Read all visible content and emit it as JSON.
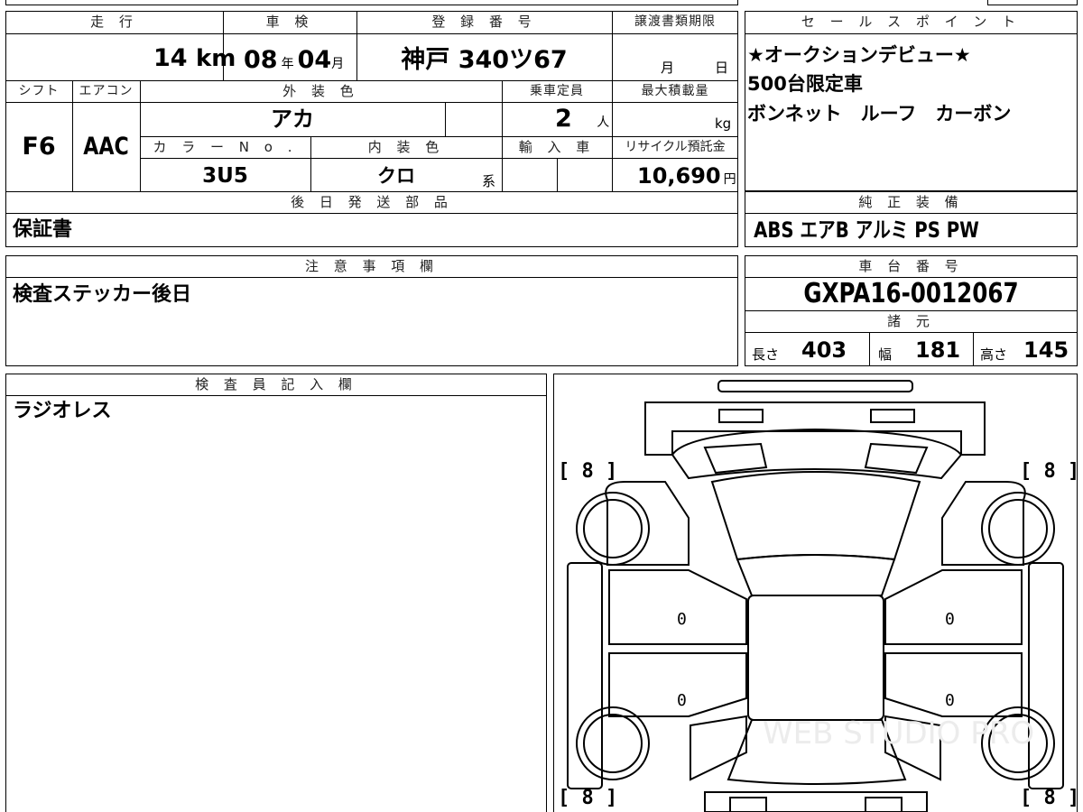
{
  "top_section": {
    "mileage": {
      "header": "走 行",
      "value": "14",
      "unit": "km"
    },
    "inspection": {
      "header": "車 検",
      "year": "08",
      "year_unit": "年",
      "month": "04",
      "month_unit": "月"
    },
    "registration": {
      "header": "登 録 番 号",
      "value": "神戸 340ツ67"
    },
    "transfer_deadline": {
      "header": "譲渡書類期限",
      "month_unit": "月",
      "day_unit": "日"
    },
    "shift": {
      "header": "シフト",
      "value": "F6"
    },
    "aircon": {
      "header": "エアコン",
      "value": "AAC"
    },
    "exterior_color": {
      "header": "外 装 色",
      "value": "アカ"
    },
    "capacity": {
      "header": "乗車定員",
      "value": "2",
      "unit": "人"
    },
    "max_load": {
      "header": "最大積載量",
      "unit": "kg"
    },
    "color_no": {
      "header": "カ ラ ー N o .",
      "value": "3U5"
    },
    "interior_color": {
      "header": "内 装 色",
      "value": "クロ",
      "unit": "系"
    },
    "import": {
      "header": "輸 入 車"
    },
    "recycle": {
      "header": "リサイクル預託金",
      "value": "10,690",
      "unit": "円"
    },
    "later_parts": {
      "header": "後 日 発 送 部 品",
      "value": "保証書"
    }
  },
  "sales_point": {
    "header": "セ ー ル ス ポ イ ン ト",
    "lines": [
      "★オークションデビュー★",
      "500台限定車",
      "ボンネット　ルーフ　カーボン"
    ]
  },
  "equipment": {
    "header": "純 正 装 備",
    "value": "ABS エアB アルミ PS PW"
  },
  "caution": {
    "header": "注 意 事 項 欄",
    "value": "検査ステッカー後日"
  },
  "chassis": {
    "header": "車 台 番 号",
    "value": "GXPA16-0012067"
  },
  "specs": {
    "header": "諸 元",
    "length_label": "長さ",
    "length": "403",
    "width_label": "幅",
    "width": "181",
    "height_label": "高さ",
    "height": "145"
  },
  "inspector": {
    "header": "検 査 員 記 入 欄",
    "value": "ラジオレス"
  },
  "diagram": {
    "tire_front_left": "[ 8 ]",
    "tire_front_right": "[ 8 ]",
    "tire_rear_left": "[ 8 ]",
    "tire_rear_right": "[ 8 ]",
    "door_front_left": "0",
    "door_rear_left": "0",
    "door_front_right": "0",
    "door_rear_right": "0",
    "watermark": "WEB STUDIO PRO"
  }
}
